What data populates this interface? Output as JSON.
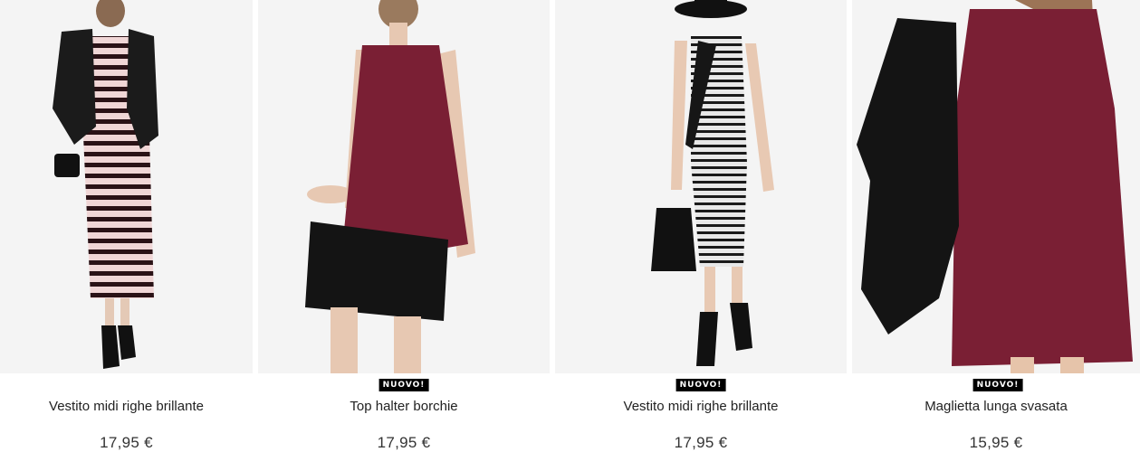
{
  "products": [
    {
      "name": "Vestito midi righe brillante",
      "price": "17,95 €",
      "badge": ""
    },
    {
      "name": "Top halter borchie",
      "price": "17,95 €",
      "badge": "NUOVO!"
    },
    {
      "name": "Vestito midi righe brillante",
      "price": "17,95 €",
      "badge": "NUOVO!"
    },
    {
      "name": "Maglietta lunga svasata",
      "price": "15,95 €",
      "badge": "NUOVO!"
    }
  ],
  "colors": {
    "burgundy": "#7a1f34",
    "black": "#141414",
    "background": "#f4f4f4",
    "badge": "#000000"
  }
}
